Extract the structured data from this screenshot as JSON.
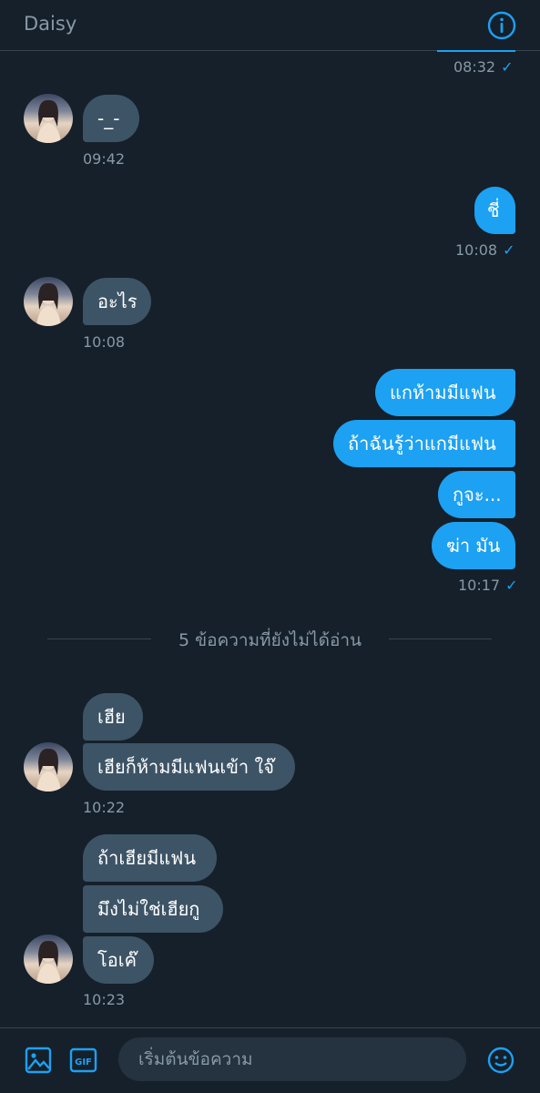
{
  "header": {
    "title": "Daisy",
    "info_icon": "info-icon"
  },
  "messages": {
    "top_time": "08:32",
    "m1": {
      "text": "-_-",
      "time": "09:42"
    },
    "m2": {
      "text": "ชี่",
      "time": "10:08"
    },
    "m3": {
      "text": "อะไร",
      "time": "10:08"
    },
    "m4": [
      "แกห้ามมีแฟน",
      "ถ้าฉันรู้ว่าแกมีแฟน",
      "กูจะ...",
      "ฆ่า มัน"
    ],
    "m4_time": "10:17",
    "unread_label": "5 ข้อความที่ยังไม่ได้อ่าน",
    "m5": [
      "เฮีย",
      "เฮียก็ห้ามมีแฟนเข้า ใจ๊"
    ],
    "m5_time": "10:22",
    "m6": [
      "ถ้าเฮียมีแฟน",
      "มึงไม่ใช่เฮียกู",
      "โอเค๊"
    ],
    "m6_time": "10:23"
  },
  "read_check": "✓",
  "composer": {
    "placeholder": "เริ่มต้นข้อความ",
    "gif_label": "GIF",
    "icons": [
      "image-icon",
      "gif-icon",
      "emoji-icon"
    ]
  },
  "colors": {
    "background": "#15202b",
    "incoming_bubble": "#3d5466",
    "outgoing_bubble": "#1da1f2",
    "accent": "#1da1f2",
    "muted_text": "#8899a6"
  }
}
